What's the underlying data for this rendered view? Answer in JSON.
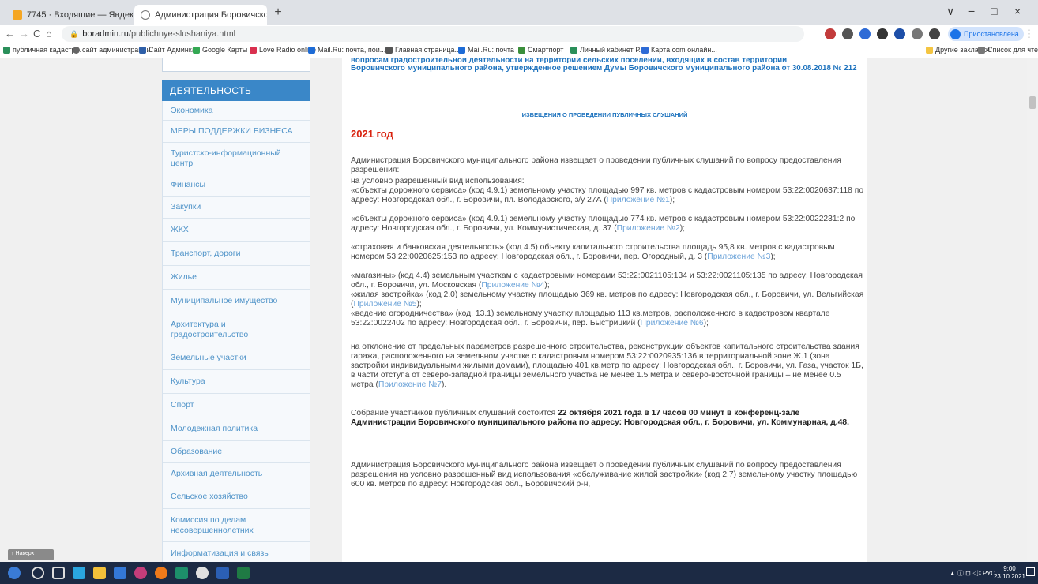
{
  "browser": {
    "tabs": [
      {
        "title": "7745 · Входящие — Яндекс.По",
        "close": "×"
      },
      {
        "title": "Администрация Боровичского",
        "close": "×"
      }
    ],
    "new_tab": "+",
    "window_controls": [
      "∨",
      "−",
      "□",
      "×"
    ],
    "nav": {
      "back": "←",
      "forward": "→",
      "reload": "C",
      "home": "⌂"
    },
    "address": {
      "host": "boradmin.ru",
      "path": "/publichnye-slushaniya.html"
    },
    "profile_status": "Приостановлена",
    "bookmarks": [
      "публичная кадастр...",
      "сайт администрации",
      "Сайт Админка",
      "Google Карты",
      "Love Radio online",
      "Mail.Ru: почта, пои...",
      "Главная страница...",
      "Mail.Ru: почта",
      "Смартпорт",
      "Личный кабинет Р...",
      "Карта com онлайн...",
      "Другие закладки",
      "Список для чтения"
    ]
  },
  "sidebar": {
    "heading": "ДЕЯТЕЛЬНОСТЬ",
    "items": [
      "Экономика",
      "МЕРЫ ПОДДЕРЖКИ БИЗНЕСА",
      "Туристско-информационный центр",
      "Финансы",
      "Закупки",
      "ЖКХ",
      "Транспорт, дороги",
      "Жилье",
      "Муниципальное имущество",
      "Архитектура и градостроительство",
      "Земельные участки",
      "Культура",
      "Спорт",
      "Молодежная политика",
      "Образование",
      "Архивная деятельность",
      "Сельское хозяйство",
      "Комиссия по делам несовершеннолетних",
      "Информатизация и связь"
    ]
  },
  "main": {
    "heading_cut": "вопросам градостроительной деятельности на территории сельских поселений, входящих в состав территории",
    "heading": "Боровичского муниципального района, утвержденное решением Думы Боровичского муниципального района от 30.08.2018 № 212",
    "notice_link": "ИЗВЕЩЕНИЯ О ПРОВЕДЕНИИ ПУБЛИЧНЫХ СЛУШАНИЙ",
    "year": "2021 год",
    "intro": "Администрация Боровичского муниципального района извещает о проведении публичных слушаний по вопросу предоставления разрешения:",
    "conditional_label": "на условно разрешенный вид использования:",
    "items": [
      {
        "text": "«объекты дорожного сервиса» (код 4.9.1) земельному участку площадью 997 кв. метров с кадастровым номером 53:22:0020637:118 по адресу: Новгородская обл., г. Боровичи, пл. Володарского, з/у 27А (",
        "link": "Приложение №1",
        "tail": ");"
      },
      {
        "text": "«объекты дорожного сервиса» (код 4.9.1) земельному участку площадью 774 кв. метров с кадастровым номером 53:22:0022231:2 по адресу: Новгородская обл., г. Боровичи, ул. Коммунистическая, д. 37 (",
        "link": "Приложение №2",
        "tail": ");"
      },
      {
        "text": "«страховая и банковская деятельность» (код 4.5) объекту капитального строительства площадь 95,8 кв. метров с кадастровым номером 53:22:0020625:153 по адресу: Новгородская обл., г. Боровичи, пер. Огородный, д. 3 (",
        "link": "Приложение №3",
        "tail": ");"
      },
      {
        "text": "«магазины» (код 4.4) земельным участкам с кадастровыми номерами 53:22:0021105:134 и 53:22:0021105:135 по адресу: Новгородская обл., г. Боровичи, ул. Московская (",
        "link": "Приложение №4",
        "tail": ");"
      },
      {
        "text": "«жилая застройка» (код 2.0) земельному участку площадью 369 кв. метров по адресу: Новгородская обл., г. Боровичи, ул. Вельгийская (",
        "link": "Приложение №5",
        "tail": ");"
      },
      {
        "text": "«ведение огородничества» (код. 13.1) земельному участку площадью 113 кв.метров, расположенного в кадастровом квартале 53:22:0022402 по адресу: Новгородская обл., г. Боровичи, пер. Быстрицкий (",
        "link": "Приложение №6",
        "tail": ");"
      }
    ],
    "deviation": {
      "text": "на отклонение от предельных параметров разрешенного строительства, реконструкции объектов капитального строительства здания гаража, расположенного на земельном участке с кадастровым номером 53:22:0020935:136 в территориальной зоне Ж.1 (зона застройки индивидуальными жилыми домами), площадью 401 кв.метр по адресу: Новгородская обл., г. Боровичи, ул. Газа, участок 1Б, в части отступа от северо-западной границы земельного участка не менее 1.5 метра и северо-восточной границы – не менее 0.5 метра (",
      "link": "Приложение №7",
      "tail": ")."
    },
    "meeting_lead": "Собрание участников публичных слушаний состоится ",
    "meeting_bold": "22 октября 2021 года в 17 часов 00 минут в конференц-зале Администрации Боровичского муниципального района по адресу: Новгородская обл., г. Боровичи, ул. Коммунарная, д.48.",
    "second_notice": "Администрация Боровичского муниципального района извещает о проведении публичных слушаний по вопросу предоставления разрешения на условно разрешенный вид использования «обслуживание жилой застройки» (код 2.7) земельному участку площадью 600 кв. метров по адресу: Новгородская обл., Боровичский р-н,",
    "back_to_top": "↑ Наверх"
  },
  "taskbar": {
    "tray": "▲ ⓘ ⊡ ◁ᵡ РУС",
    "time": "9:00",
    "date": "23.10.2021"
  }
}
